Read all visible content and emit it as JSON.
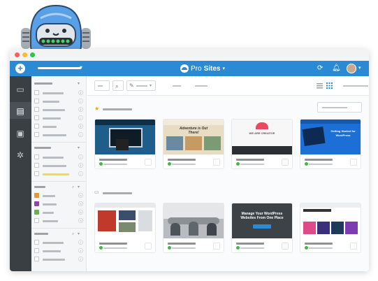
{
  "topbar": {
    "add_icon": "plus-icon",
    "brand_prefix": "Pro",
    "brand_main": "Sites",
    "brand_caret": "▾",
    "site_caret": "▾",
    "refresh_icon": "refresh-icon",
    "bell_icon": "bell-icon",
    "avatar_caret": "▾"
  },
  "leftbar": {
    "items": [
      {
        "icon": "monitor-icon"
      },
      {
        "icon": "sites-icon"
      },
      {
        "icon": "id-card-icon"
      },
      {
        "icon": "gear-icon"
      }
    ]
  },
  "panel": {
    "group1_counts": [
      "2",
      "2",
      "2",
      "2",
      "2",
      "2"
    ],
    "group2_counts": [
      "2",
      "2",
      "2"
    ],
    "group3_counts": [
      "5",
      "5",
      "5",
      "5"
    ],
    "group4_counts": [
      "2",
      "4",
      "2"
    ]
  },
  "colors": {
    "topbar": "#2b8ad4",
    "leftbar": "#3a3f44",
    "swatch_orange": "#f0932b",
    "swatch_purple": "#8e44ad",
    "swatch_green": "#6ab04c",
    "accent_star": "#f0a500"
  },
  "main": {
    "favorites_icon": "star-icon",
    "folder_icon": "folder-icon",
    "card_thumbs": {
      "card6_title": "Manage Your WordPress Websites From One Place",
      "card4_title": "Getting Started for WordPress",
      "card2_title": "Adventure is Out There!",
      "card3_title": "WE ARE CREATIVE"
    }
  }
}
